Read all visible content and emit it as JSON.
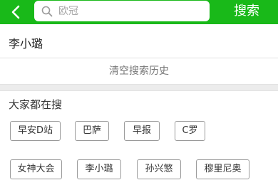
{
  "header": {
    "search_placeholder": "欧冠",
    "search_button": "搜索",
    "accent_color": "#19b919"
  },
  "history": {
    "items": [
      "李小璐"
    ],
    "clear_label": "清空搜索历史"
  },
  "hot": {
    "title": "大家都在搜",
    "tags": [
      "早安D站",
      "巴萨",
      "早报",
      "C罗",
      "女神大会",
      "李小璐",
      "孙兴慜",
      "穆里尼奥"
    ]
  }
}
